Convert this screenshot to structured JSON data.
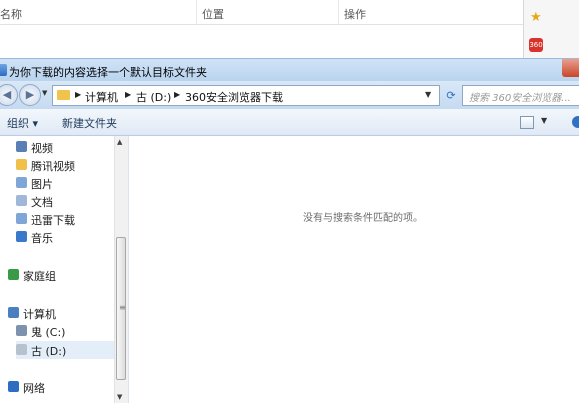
{
  "background": {
    "columns": [
      "名称",
      "位置",
      "操作"
    ],
    "badge": "360"
  },
  "dialog": {
    "title": "为你下载的内容选择一个默认目标文件夹",
    "breadcrumbs": [
      "计算机",
      "古 (D:)",
      "360安全浏览器下载"
    ],
    "search_placeholder": "搜索 360安全浏览器...",
    "toolbar": {
      "organize": "组织 ▾",
      "new_folder": "新建文件夹"
    },
    "nav_items": [
      {
        "label": "视频",
        "icon": "video-library-icon",
        "color": "#5a7fb5"
      },
      {
        "label": "腾讯视频",
        "icon": "folder-icon",
        "color": "#f0c04a"
      },
      {
        "label": "图片",
        "icon": "pictures-library-icon",
        "color": "#7fa6d6"
      },
      {
        "label": "文档",
        "icon": "documents-library-icon",
        "color": "#9fb8d8"
      },
      {
        "label": "迅雷下载",
        "icon": "download-library-icon",
        "color": "#7fa6d6"
      },
      {
        "label": "音乐",
        "icon": "music-library-icon",
        "color": "#3a79c9"
      },
      {
        "label": "家庭组",
        "icon": "homegroup-icon",
        "color": "#3a9a4a"
      },
      {
        "label": "计算机",
        "icon": "computer-icon",
        "color": "#4a7fc0"
      },
      {
        "label": "鬼 (C:)",
        "icon": "windows-drive-icon",
        "color": "#7d93ad"
      },
      {
        "label": "古 (D:)",
        "icon": "drive-icon",
        "color": "#b7c2cf"
      },
      {
        "label": "网络",
        "icon": "network-icon",
        "color": "#2e6ec2"
      }
    ],
    "empty_message": "没有与搜索条件匹配的项。"
  }
}
